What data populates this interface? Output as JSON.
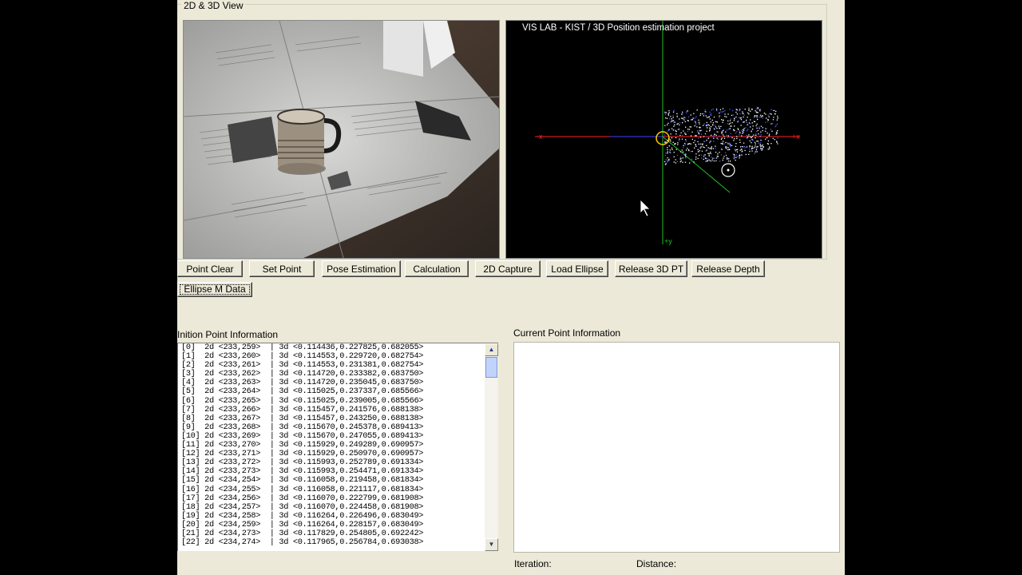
{
  "group_title": "2D & 3D View",
  "plot": {
    "title": "VIS LAB - KIST / 3D Position estimation project",
    "axis_labels": {
      "neg_x": "-x",
      "pos_x": "+x",
      "pos_y": "+y"
    }
  },
  "buttons": {
    "point_clear": "Point Clear",
    "set_point": "Set Point",
    "pose_estimation": "Pose Estimation",
    "calculation": "Calculation",
    "capture_2d": "2D Capture",
    "load_ellipse": "Load Ellipse",
    "release_3d_pt": "Release 3D PT",
    "release_depth": "Release Depth",
    "ellipse_m_data": "Ellipse M Data"
  },
  "init_panel": {
    "title": "Inition Point Information",
    "items": [
      "[0]  2d <233,259>  | 3d <0.114436,0.227825,0.682055>",
      "[1]  2d <233,260>  | 3d <0.114553,0.229720,0.682754>",
      "[2]  2d <233,261>  | 3d <0.114553,0.231381,0.682754>",
      "[3]  2d <233,262>  | 3d <0.114720,0.233382,0.683750>",
      "[4]  2d <233,263>  | 3d <0.114720,0.235045,0.683750>",
      "[5]  2d <233,264>  | 3d <0.115025,0.237337,0.685566>",
      "[6]  2d <233,265>  | 3d <0.115025,0.239005,0.685566>",
      "[7]  2d <233,266>  | 3d <0.115457,0.241576,0.688138>",
      "[8]  2d <233,267>  | 3d <0.115457,0.243250,0.688138>",
      "[9]  2d <233,268>  | 3d <0.115670,0.245378,0.689413>",
      "[10] 2d <233,269>  | 3d <0.115670,0.247055,0.689413>",
      "[11] 2d <233,270>  | 3d <0.115929,0.249289,0.690957>",
      "[12] 2d <233,271>  | 3d <0.115929,0.250970,0.690957>",
      "[13] 2d <233,272>  | 3d <0.115993,0.252789,0.691334>",
      "[14] 2d <233,273>  | 3d <0.115993,0.254471,0.691334>",
      "[15] 2d <234,254>  | 3d <0.116058,0.219458,0.681834>",
      "[16] 2d <234,255>  | 3d <0.116058,0.221117,0.681834>",
      "[17] 2d <234,256>  | 3d <0.116070,0.222799,0.681908>",
      "[18] 2d <234,257>  | 3d <0.116070,0.224458,0.681908>",
      "[19] 2d <234,258>  | 3d <0.116264,0.226496,0.683049>",
      "[20] 2d <234,259>  | 3d <0.116264,0.228157,0.683049>",
      "[21] 2d <234,273>  | 3d <0.117829,0.254805,0.692242>",
      "[22] 2d <234,274>  | 3d <0.117965,0.256784,0.693038>"
    ]
  },
  "current_panel": {
    "title": "Current Point Information"
  },
  "status": {
    "iteration_label": "Iteration:",
    "distance_label": "Distance:"
  },
  "icons": {
    "scroll_up": "scroll-up-icon",
    "scroll_down": "scroll-down-icon",
    "cursor": "mouse-cursor-icon"
  },
  "colors": {
    "window_bg": "#ece9d8",
    "plot_bg": "#000000",
    "x_axis": "#ff2020",
    "y_axis": "#20c020",
    "points": "#ffffff"
  }
}
